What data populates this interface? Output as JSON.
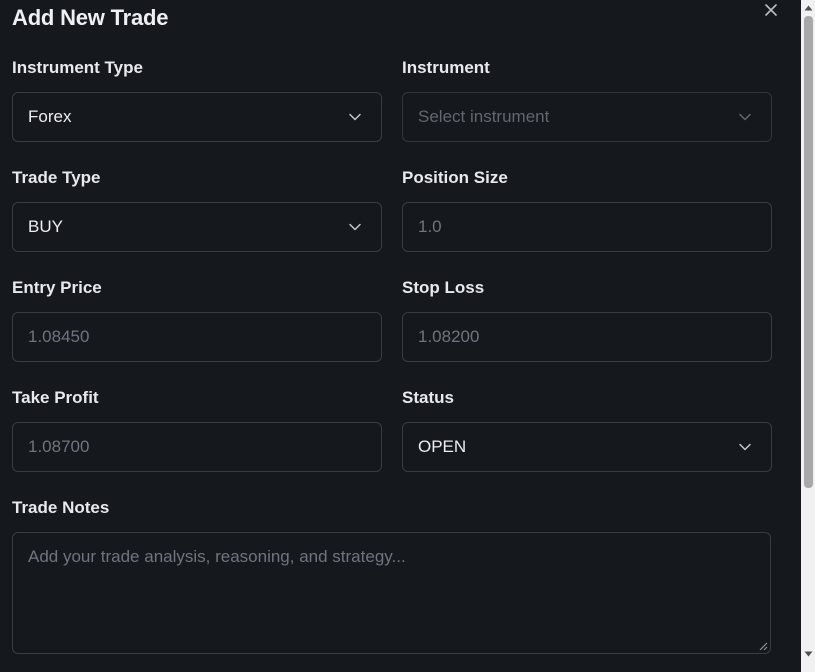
{
  "dialog": {
    "title": "Add New Trade",
    "close_icon": "close-icon"
  },
  "form": {
    "instrument_type": {
      "label": "Instrument Type",
      "value": "Forex"
    },
    "instrument": {
      "label": "Instrument",
      "placeholder": "Select instrument"
    },
    "trade_type": {
      "label": "Trade Type",
      "value": "BUY"
    },
    "position_size": {
      "label": "Position Size",
      "placeholder": "1.0"
    },
    "entry_price": {
      "label": "Entry Price",
      "placeholder": "1.08450"
    },
    "stop_loss": {
      "label": "Stop Loss",
      "placeholder": "1.08200"
    },
    "take_profit": {
      "label": "Take Profit",
      "placeholder": "1.08700"
    },
    "status": {
      "label": "Status",
      "value": "OPEN"
    },
    "trade_notes": {
      "label": "Trade Notes",
      "placeholder": "Add your trade analysis, reasoning, and strategy..."
    }
  },
  "colors": {
    "background": "#15181d",
    "border": "#383d45",
    "text": "#eceef1",
    "placeholder": "#6f757e"
  }
}
